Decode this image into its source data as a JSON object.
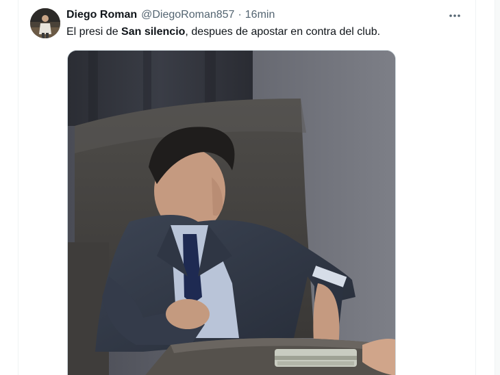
{
  "tweet": {
    "author": {
      "display_name": "Diego Roman",
      "handle": "@DiegoRoman857"
    },
    "separator": "·",
    "timestamp": "16min",
    "text": {
      "before": "El presi de ",
      "bold": "San silencio",
      "after": ", despues de apostar en contra del club."
    },
    "more_icon": "more-horizontal-icon",
    "media_description": "photo"
  },
  "colors": {
    "text_primary": "#0f1419",
    "text_secondary": "#536471",
    "border": "#cfd9de"
  }
}
